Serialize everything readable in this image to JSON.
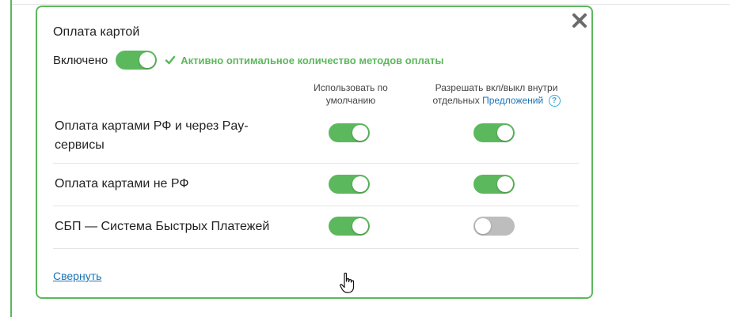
{
  "card": {
    "title": "Оплата картой",
    "close_icon": "close-x-icon"
  },
  "enabled": {
    "label": "Включено",
    "toggle_on": true,
    "status_icon": "check-icon",
    "status_text": "Активно оптимальное количество методов оплаты"
  },
  "columns": {
    "default_line1": "Использовать по",
    "default_line2": "умолчанию",
    "allow_line1": "Разрешать вкл/выкл внутри",
    "allow_prefix": "отдельных",
    "allow_link": "Предложений",
    "help_icon": "?"
  },
  "methods": [
    {
      "label_line1": "Оплата картами РФ и через Pay-",
      "label_line2": "сервисы",
      "default_on": true,
      "allow_on": true
    },
    {
      "label_line1": "Оплата картами не РФ",
      "label_line2": "",
      "default_on": true,
      "allow_on": true
    },
    {
      "label_line1": "СБП — Система Быстрых Платежей",
      "label_line2": "",
      "default_on": true,
      "allow_on": false
    }
  ],
  "collapse_link": "Свернуть",
  "colors": {
    "accent_green": "#5cb85c",
    "toggle_off": "#bdbdbd",
    "link_blue": "#1a73b5"
  }
}
